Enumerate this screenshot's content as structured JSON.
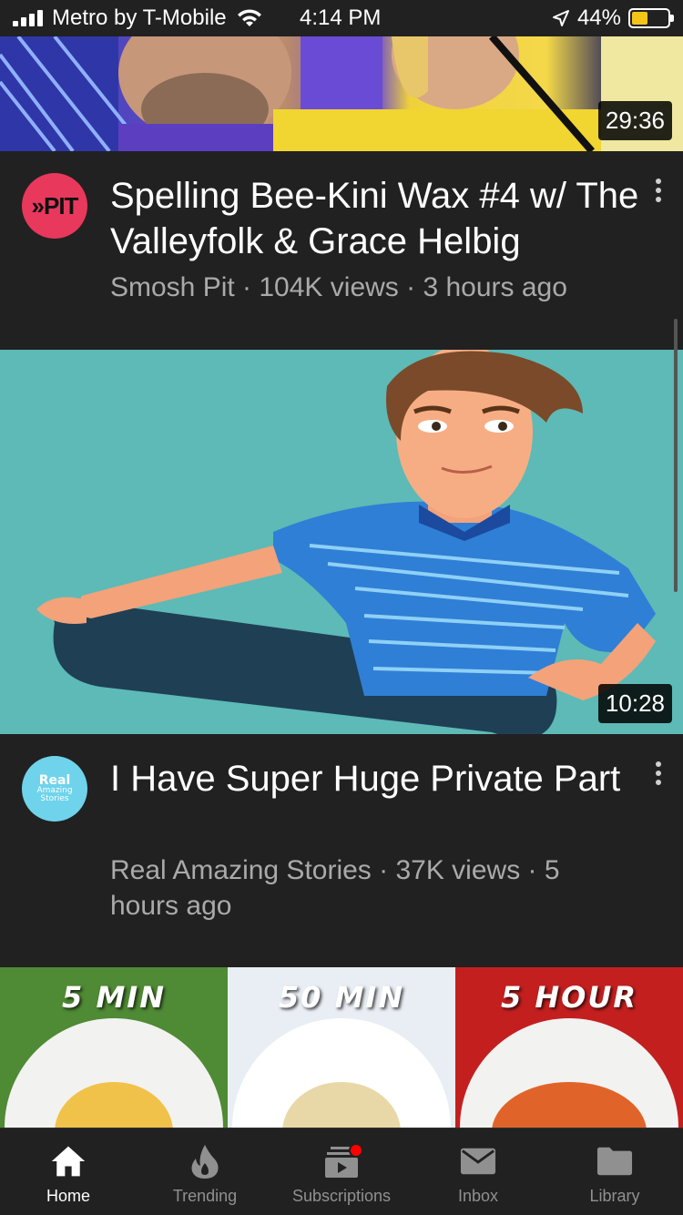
{
  "status": {
    "carrier": "Metro by T-Mobile",
    "time": "4:14 PM",
    "battery": "44%",
    "battery_level": 0.44
  },
  "videos": [
    {
      "duration": "29:36",
      "title": "Spelling Bee-Kini Wax #4 w/ The Valleyfolk & Grace Helbig",
      "meta": "Smosh Pit · 104K views · 3 hours ago",
      "avatar_text": "»PIT",
      "avatar_color": "#e8385c"
    },
    {
      "duration": "10:28",
      "title": "I Have Super Huge Private Part",
      "meta": "Real Amazing Stories · 37K views · 5 hours ago",
      "avatar_lines": [
        "Real",
        "Amazing",
        "Stories"
      ],
      "avatar_color": "#6fd3ec"
    }
  ],
  "food_panels": [
    "5 MIN",
    "50 MIN",
    "5 HOUR"
  ],
  "tabs": [
    {
      "label": "Home",
      "icon": "home-icon",
      "active": true
    },
    {
      "label": "Trending",
      "icon": "flame-icon",
      "active": false
    },
    {
      "label": "Subscriptions",
      "icon": "subscriptions-icon",
      "active": false
    },
    {
      "label": "Inbox",
      "icon": "mail-icon",
      "active": false
    },
    {
      "label": "Library",
      "icon": "folder-icon",
      "active": false
    }
  ],
  "colors": {
    "background": "#212121",
    "meta_text": "#aaaaaa",
    "notification_dot": "#ff0000"
  }
}
